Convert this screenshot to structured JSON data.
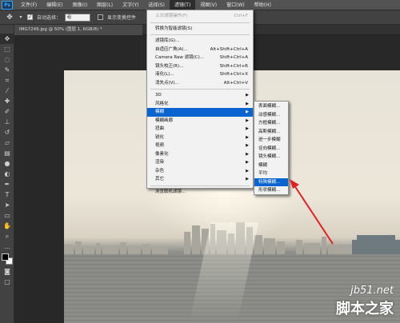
{
  "app": {
    "logo": "Ps"
  },
  "menubar": {
    "items": [
      "文件(F)",
      "编辑(E)",
      "图像(I)",
      "图层(L)",
      "文字(Y)",
      "选择(S)",
      "滤镜(T)",
      "视图(V)",
      "窗口(W)",
      "帮助(H)"
    ],
    "active_index": 6
  },
  "options_bar": {
    "auto_select_label": "自动选择：",
    "auto_select_value": "组",
    "transform_label": "显示变换控件"
  },
  "document": {
    "tab_title": "IMG7249.jpg @ 50% (图层 1, RGB/8) *"
  },
  "filter_menu": {
    "items": [
      {
        "label": "上次滤镜操作(F)",
        "shortcut": "Ctrl+F",
        "disabled": true
      },
      {
        "sep": true
      },
      {
        "label": "转换为智能滤镜(S)"
      },
      {
        "sep": true
      },
      {
        "label": "滤镜库(G)..."
      },
      {
        "label": "自适应广角(A)...",
        "shortcut": "Alt+Shift+Ctrl+A"
      },
      {
        "label": "Camera Raw 滤镜(C)...",
        "shortcut": "Shift+Ctrl+A"
      },
      {
        "label": "镜头校正(R)...",
        "shortcut": "Shift+Ctrl+R"
      },
      {
        "label": "液化(L)...",
        "shortcut": "Shift+Ctrl+X"
      },
      {
        "label": "消失点(V)...",
        "shortcut": "Alt+Ctrl+V"
      },
      {
        "sep": true
      },
      {
        "label": "3D",
        "submenu": true
      },
      {
        "label": "风格化",
        "submenu": true
      },
      {
        "label": "模糊",
        "submenu": true,
        "highlight": true
      },
      {
        "label": "模糊画廊",
        "submenu": true
      },
      {
        "label": "扭曲",
        "submenu": true
      },
      {
        "label": "锐化",
        "submenu": true
      },
      {
        "label": "视频",
        "submenu": true
      },
      {
        "label": "像素化",
        "submenu": true
      },
      {
        "label": "渲染",
        "submenu": true
      },
      {
        "label": "杂色",
        "submenu": true
      },
      {
        "label": "其它",
        "submenu": true
      },
      {
        "sep": true
      },
      {
        "label": "浏览联机滤镜..."
      }
    ]
  },
  "blur_submenu": {
    "items": [
      {
        "label": "表面模糊..."
      },
      {
        "label": "动感模糊..."
      },
      {
        "label": "方框模糊..."
      },
      {
        "label": "高斯模糊..."
      },
      {
        "label": "进一步模糊"
      },
      {
        "label": "径向模糊..."
      },
      {
        "label": "镜头模糊..."
      },
      {
        "label": "模糊"
      },
      {
        "label": "平均"
      },
      {
        "label": "特殊模糊...",
        "highlight": true
      },
      {
        "label": "形状模糊..."
      }
    ]
  },
  "watermark": {
    "site": "jb51.net",
    "name": "脚本之家"
  },
  "colors": {
    "highlight": "#0a64cf",
    "arrow": "#e02020"
  }
}
